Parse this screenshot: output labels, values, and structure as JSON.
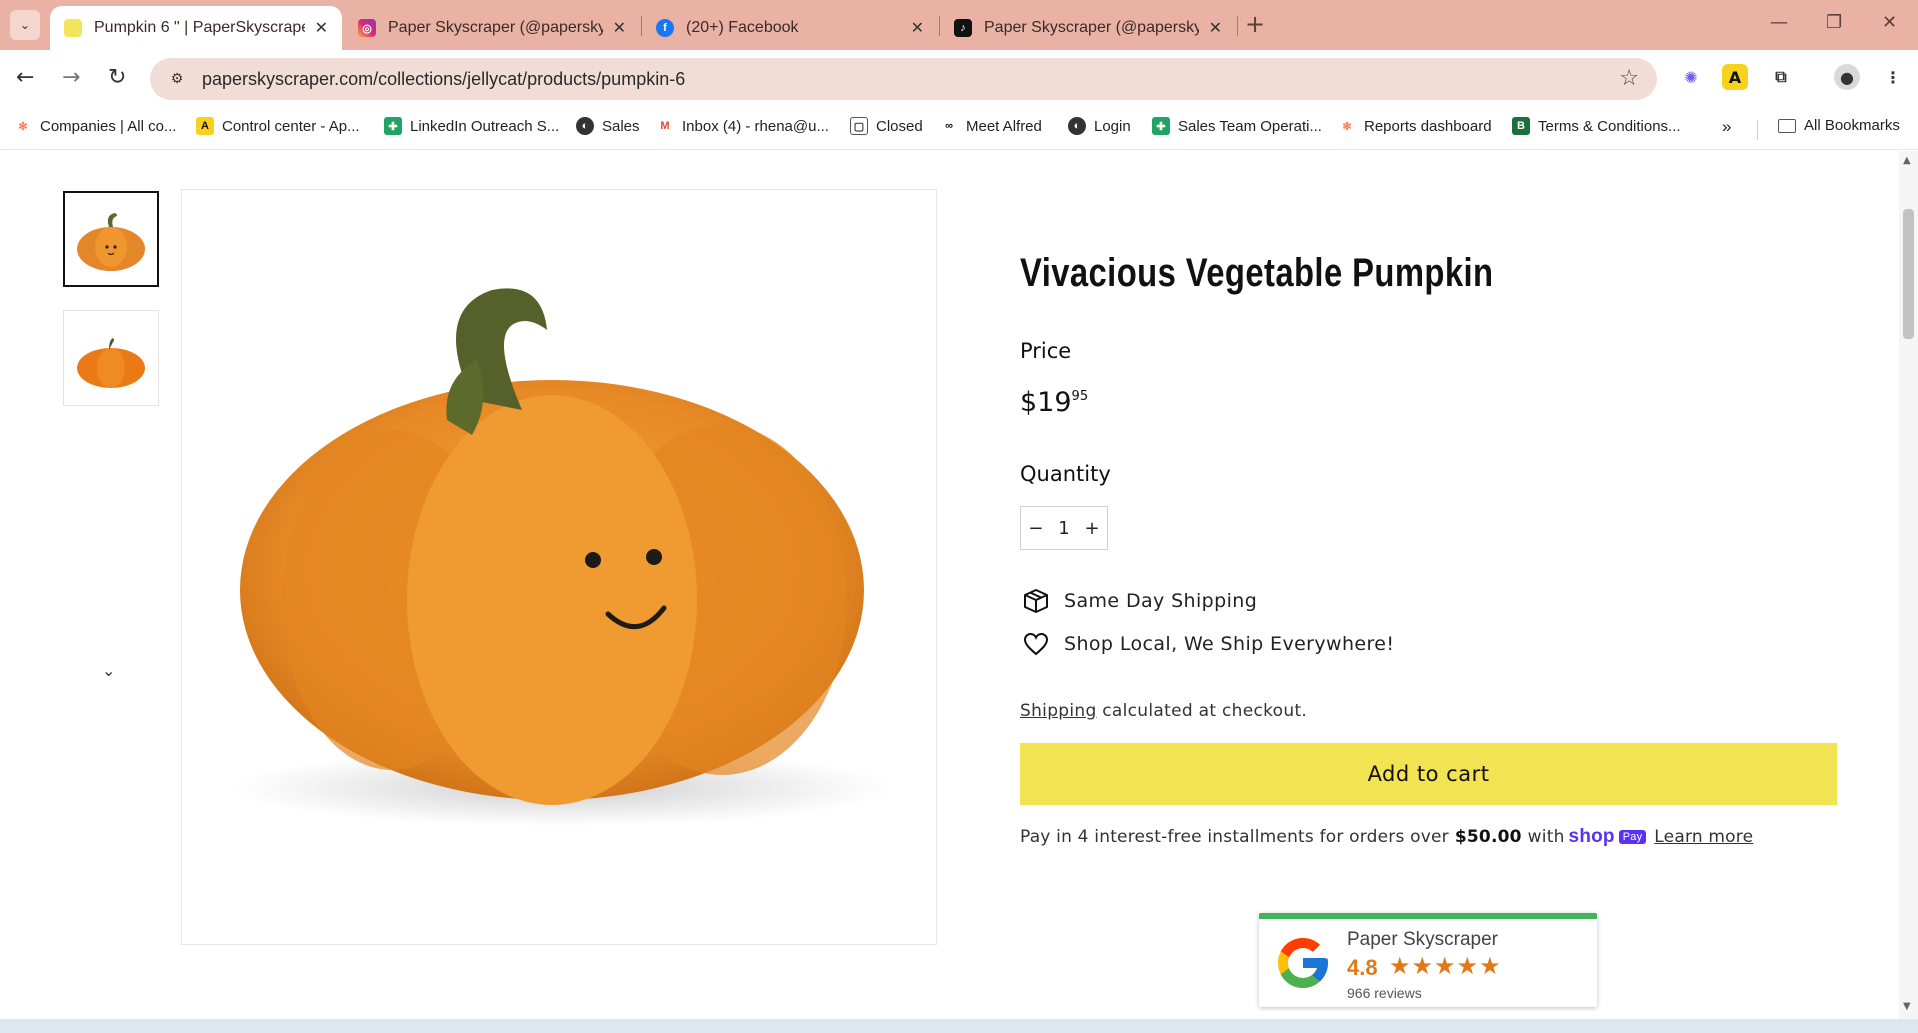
{
  "browser": {
    "tabs": [
      {
        "title": "Pumpkin 6 \" | PaperSkyscraper.c",
        "favicon": "paper-skyscraper",
        "active": true
      },
      {
        "title": "Paper Skyscraper (@paperskysc",
        "favicon": "instagram",
        "active": false
      },
      {
        "title": "(20+) Facebook",
        "favicon": "facebook",
        "active": false
      },
      {
        "title": "Paper Skyscraper (@paperskysc",
        "favicon": "tiktok",
        "active": false
      }
    ],
    "url": "paperskyscraper.com/collections/jellycat/products/pumpkin-6",
    "bookmarks": [
      {
        "label": "Companies | All co...",
        "icon": "hubspot"
      },
      {
        "label": "Control center - Ap...",
        "icon": "apollo"
      },
      {
        "label": "LinkedIn Outreach S...",
        "icon": "sheets"
      },
      {
        "label": "Sales",
        "icon": "globe"
      },
      {
        "label": "Inbox (4) - rhena@u...",
        "icon": "gmail"
      },
      {
        "label": "Closed",
        "icon": "document"
      },
      {
        "label": "Meet Alfred",
        "icon": "alfred"
      },
      {
        "label": "Login",
        "icon": "globe"
      },
      {
        "label": "Sales Team Operati...",
        "icon": "sheets"
      },
      {
        "label": "Reports dashboard",
        "icon": "hubspot"
      },
      {
        "label": "Terms & Conditions...",
        "icon": "bitrix"
      }
    ],
    "bookmarks_more": "»",
    "all_bookmarks": "All Bookmarks"
  },
  "product": {
    "title": "Vivacious Vegetable Pumpkin",
    "price_label": "Price",
    "price_main": "$19",
    "price_cents": "95",
    "quantity_label": "Quantity",
    "quantity_value": "1",
    "qty_minus": "−",
    "qty_plus": "+",
    "features": [
      {
        "icon": "box-icon",
        "text": "Same Day Shipping"
      },
      {
        "icon": "heart-icon",
        "text": "Shop Local, We Ship Everywhere!"
      }
    ],
    "shipping_link": "Shipping",
    "shipping_note": " calculated at checkout.",
    "add_to_cart": "Add to cart",
    "pay_prefix": "Pay in 4 interest-free installments for orders over",
    "pay_amount": "$50.00",
    "pay_with": "with",
    "shop_brand": "shop",
    "shop_pay_badge": "Pay",
    "learn_more": "Learn more",
    "accent_color": "#f2e352"
  },
  "google_review": {
    "name": "Paper Skyscraper",
    "rating": "4.8",
    "stars": "★★★★★",
    "count": "966 reviews"
  }
}
